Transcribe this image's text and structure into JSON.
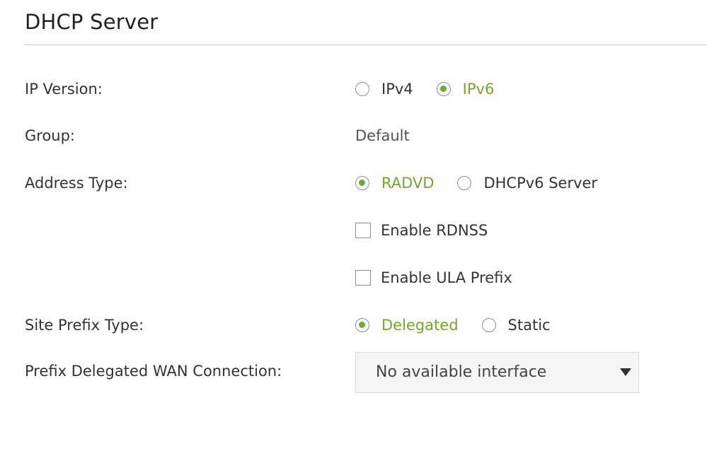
{
  "section": {
    "title": "DHCP Server"
  },
  "ip_version": {
    "label": "IP Version:",
    "options": [
      {
        "label": "IPv4",
        "checked": false
      },
      {
        "label": "IPv6",
        "checked": true
      }
    ]
  },
  "group": {
    "label": "Group:",
    "value": "Default"
  },
  "address_type": {
    "label": "Address Type:",
    "options": [
      {
        "label": "RADVD",
        "checked": true
      },
      {
        "label": "DHCPv6 Server",
        "checked": false
      }
    ]
  },
  "enable_rdnss": {
    "label": "Enable RDNSS",
    "checked": false
  },
  "enable_ula_prefix": {
    "label": "Enable ULA Prefix",
    "checked": false
  },
  "site_prefix_type": {
    "label": "Site Prefix Type:",
    "options": [
      {
        "label": "Delegated",
        "checked": true
      },
      {
        "label": "Static",
        "checked": false
      }
    ]
  },
  "prefix_delegated_wan": {
    "label": "Prefix Delegated WAN Connection:",
    "selected": "No available interface"
  },
  "colors": {
    "accent": "#6faa2a",
    "text": "#333333",
    "divider": "#c8c8c8",
    "select_bg": "#f5f5f5"
  },
  "icons": {
    "select_caret": "caret-down-icon"
  }
}
